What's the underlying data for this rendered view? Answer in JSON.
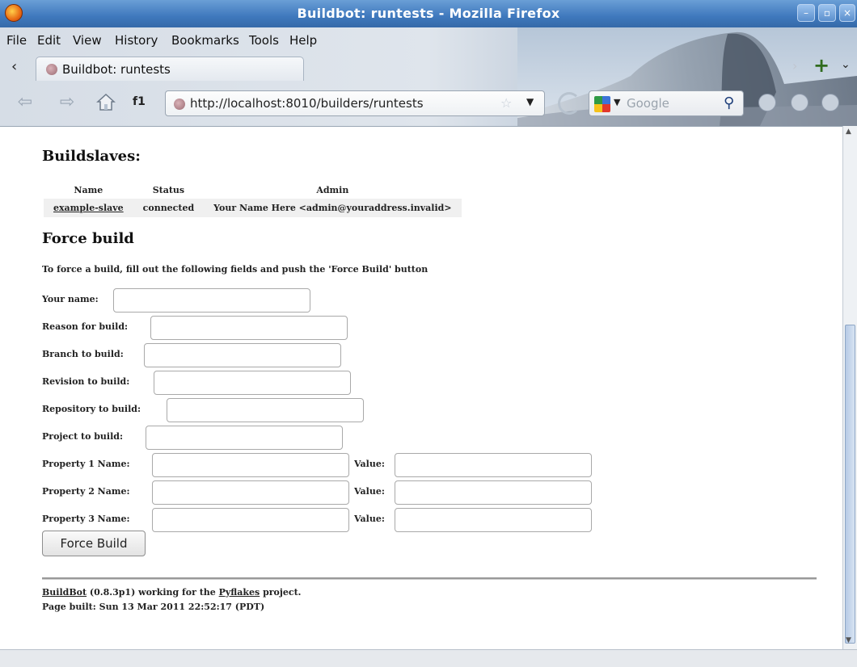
{
  "window": {
    "title": "Buildbot: runtests - Mozilla Firefox",
    "controls": [
      "minimize",
      "maximize",
      "close"
    ]
  },
  "menubar": {
    "items": [
      {
        "label": "File",
        "accesskey": "F"
      },
      {
        "label": "Edit",
        "accesskey": "E"
      },
      {
        "label": "View",
        "accesskey": "V"
      },
      {
        "label": "History",
        "accesskey": "s"
      },
      {
        "label": "Bookmarks",
        "accesskey": "B"
      },
      {
        "label": "Tools",
        "accesskey": "T"
      },
      {
        "label": "Help",
        "accesskey": "H"
      }
    ]
  },
  "tabs": {
    "scroll_left": "‹",
    "active_tab_label": "Buildbot: runtests",
    "scroll_right": "›",
    "new_tab": "+",
    "list_all": "⌄"
  },
  "navbar": {
    "back_icon": "back-arrow-icon",
    "forward_icon": "forward-arrow-icon",
    "home_icon": "home-icon",
    "bookmark_keyword": "f1",
    "url": "http://localhost:8010/builders/runtests",
    "search_engine_placeholder": "Google"
  },
  "page": {
    "buildslaves_heading": "Buildslaves:",
    "slaves_table": {
      "headers": [
        "Name",
        "Status",
        "Admin"
      ],
      "rows": [
        {
          "name": "example-slave",
          "status": "connected",
          "admin": "Your Name Here <admin@youraddress.invalid>"
        }
      ]
    },
    "force_heading": "Force build",
    "intro": "To force a build, fill out the following fields and push the 'Force Build' button",
    "fields": {
      "your_name": {
        "label": "Your name:",
        "value": ""
      },
      "reason": {
        "label": "Reason for build:",
        "value": ""
      },
      "branch": {
        "label": "Branch to build:",
        "value": ""
      },
      "revision": {
        "label": "Revision to build:",
        "value": ""
      },
      "repository": {
        "label": "Repository to build:",
        "value": ""
      },
      "project": {
        "label": "Project to build:",
        "value": ""
      }
    },
    "properties": [
      {
        "name_label": "Property 1 Name:",
        "value_label": "Value:"
      },
      {
        "name_label": "Property 2 Name:",
        "value_label": "Value:"
      },
      {
        "name_label": "Property 3 Name:",
        "value_label": "Value:"
      }
    ],
    "force_button": "Force Build",
    "footer": {
      "buildbot_link": "BuildBot",
      "version_text": " (0.8.3p1) working for the ",
      "project_link": "Pyflakes",
      "project_suffix": " project.",
      "page_built": "Page built: Sun 13 Mar 2011 22:52:17 (PDT)"
    }
  }
}
